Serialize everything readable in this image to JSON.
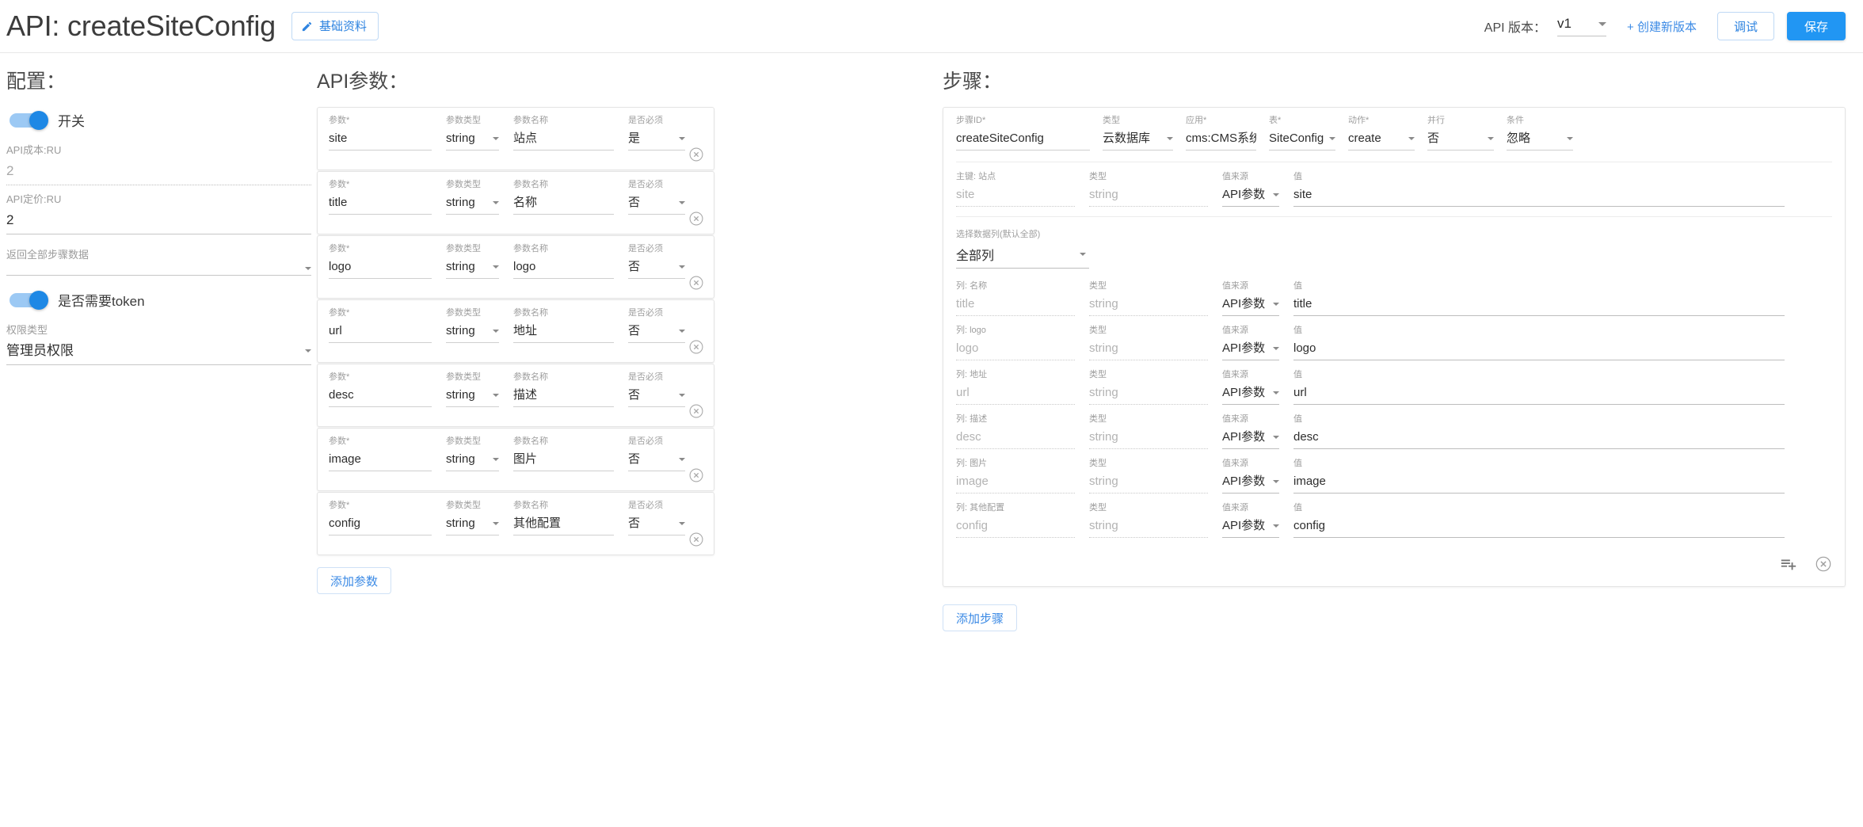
{
  "header": {
    "title": "API: createSiteConfig",
    "basic_info_button": "基础资料",
    "edit_icon": "pencil-icon",
    "version_label": "API 版本：",
    "version_value": "v1",
    "create_version_link": "+ 创建新版本",
    "debug_button": "调试",
    "save_button": "保存",
    "accent": "#2196f3"
  },
  "config": {
    "title": "配置：",
    "switch_label": "开关",
    "switch_on": true,
    "cost_label": "API成本:RU",
    "cost_value": "2",
    "price_label": "API定价:RU",
    "price_value": "2",
    "return_all_steps_label": "返回全部步骤数据",
    "return_all_steps_value": "",
    "token_switch_label": "是否需要token",
    "token_switch_on": true,
    "auth_type_label": "权限类型",
    "auth_type_value": "管理员权限"
  },
  "params": {
    "title": "API参数：",
    "labels": {
      "name": "参数",
      "type": "参数类型",
      "display": "参数名称",
      "required": "是否必须",
      "required_mark": "*"
    },
    "add_button": "添加参数",
    "remove_icon": "remove-circle-icon",
    "rows": [
      {
        "name": "site",
        "type": "string",
        "display": "站点",
        "required": "是"
      },
      {
        "name": "title",
        "type": "string",
        "display": "名称",
        "required": "否"
      },
      {
        "name": "logo",
        "type": "string",
        "display": "logo",
        "required": "否"
      },
      {
        "name": "url",
        "type": "string",
        "display": "地址",
        "required": "否"
      },
      {
        "name": "desc",
        "type": "string",
        "display": "描述",
        "required": "否"
      },
      {
        "name": "image",
        "type": "string",
        "display": "图片",
        "required": "否"
      },
      {
        "name": "config",
        "type": "string",
        "display": "其他配置",
        "required": "否"
      }
    ]
  },
  "steps": {
    "title": "步骤：",
    "head_labels": {
      "step_id": "步骤ID",
      "type": "类型",
      "app": "应用",
      "table": "表",
      "action": "动作",
      "parallel": "并行",
      "condition": "条件",
      "required_mark": "*"
    },
    "head_values": {
      "step_id": "createSiteConfig",
      "type": "云数据库",
      "app": "cms:CMS系统",
      "table": "SiteConfig",
      "action": "create",
      "parallel": "否",
      "condition": "忽略"
    },
    "kv_labels": {
      "type": "类型",
      "source": "值来源",
      "value": "值"
    },
    "primary_key": {
      "label": "主键: 站点",
      "field": "site",
      "type": "string",
      "source": "API参数",
      "value": "site"
    },
    "column_select": {
      "label": "选择数据列(默认全部)",
      "value": "全部列"
    },
    "columns": [
      {
        "label": "列: 名称",
        "field": "title",
        "type": "string",
        "source": "API参数",
        "value": "title"
      },
      {
        "label": "列: logo",
        "field": "logo",
        "type": "string",
        "source": "API参数",
        "value": "logo"
      },
      {
        "label": "列: 地址",
        "field": "url",
        "type": "string",
        "source": "API参数",
        "value": "url"
      },
      {
        "label": "列: 描述",
        "field": "desc",
        "type": "string",
        "source": "API参数",
        "value": "desc"
      },
      {
        "label": "列: 图片",
        "field": "image",
        "type": "string",
        "source": "API参数",
        "value": "image"
      },
      {
        "label": "列: 其他配置",
        "field": "config",
        "type": "string",
        "source": "API参数",
        "value": "config"
      }
    ],
    "playlist_add_icon": "playlist-add-icon",
    "remove_icon": "remove-circle-icon",
    "add_step_button": "添加步骤"
  }
}
